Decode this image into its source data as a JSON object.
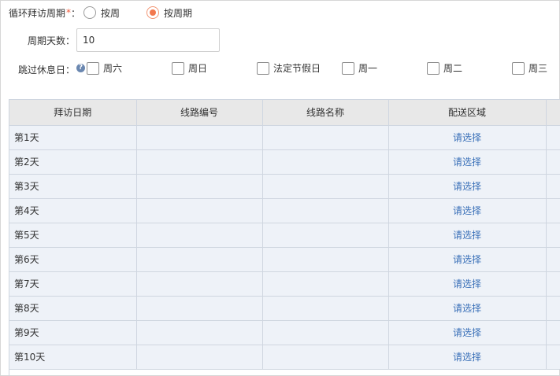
{
  "cycle": {
    "label": "循环拜访周期",
    "required_mark": "*",
    "colon": "：",
    "options": [
      {
        "label": "按周",
        "selected": false
      },
      {
        "label": "按周期",
        "selected": true
      }
    ]
  },
  "period_days": {
    "label": "周期天数：",
    "value": "10"
  },
  "skip_rest": {
    "label": "跳过休息日：",
    "help_icon": "?",
    "options": [
      "周六",
      "周日",
      "法定节假日",
      "周一",
      "周二",
      "周三"
    ]
  },
  "table": {
    "headers": [
      "拜访日期",
      "线路编号",
      "线路名称",
      "配送区域"
    ],
    "select_text": "请选择",
    "rows": [
      {
        "day": "第1天",
        "route_no": "",
        "route_name": "",
        "area": "请选择"
      },
      {
        "day": "第2天",
        "route_no": "",
        "route_name": "",
        "area": "请选择"
      },
      {
        "day": "第3天",
        "route_no": "",
        "route_name": "",
        "area": "请选择"
      },
      {
        "day": "第4天",
        "route_no": "",
        "route_name": "",
        "area": "请选择"
      },
      {
        "day": "第5天",
        "route_no": "",
        "route_name": "",
        "area": "请选择"
      },
      {
        "day": "第6天",
        "route_no": "",
        "route_name": "",
        "area": "请选择"
      },
      {
        "day": "第7天",
        "route_no": "",
        "route_name": "",
        "area": "请选择"
      },
      {
        "day": "第8天",
        "route_no": "",
        "route_name": "",
        "area": "请选择"
      },
      {
        "day": "第9天",
        "route_no": "",
        "route_name": "",
        "area": "请选择"
      },
      {
        "day": "第10天",
        "route_no": "",
        "route_name": "",
        "area": "请选择"
      }
    ]
  },
  "colors": {
    "accent": "#f2784e",
    "link": "#3a70b8",
    "required": "#f05a3a"
  }
}
